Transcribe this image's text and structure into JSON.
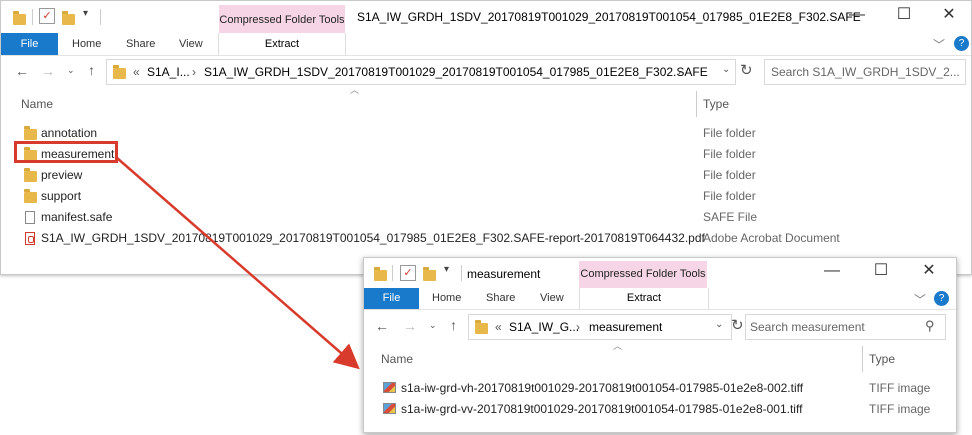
{
  "window_main": {
    "title": "S1A_IW_GRDH_1SDV_20170819T001029_20170819T001054_017985_01E2E8_F302.SAFE",
    "context_tab": "Compressed Folder Tools",
    "ribbon_tabs": [
      "File",
      "Home",
      "Share",
      "View"
    ],
    "extract_label": "Extract",
    "address": {
      "prefix": "«",
      "crumbs": [
        "S1A_I...",
        "S1A_IW_GRDH_1SDV_20170819T001029_20170819T001054_017985_01E2E8_F302.SAFE"
      ]
    },
    "search_placeholder": "Search S1A_IW_GRDH_1SDV_2...",
    "columns": {
      "name": "Name",
      "type": "Type"
    },
    "items": [
      {
        "name": "annotation",
        "type": "File folder",
        "icon": "folder-icon"
      },
      {
        "name": "measurement",
        "type": "File folder",
        "icon": "folder-icon"
      },
      {
        "name": "preview",
        "type": "File folder",
        "icon": "folder-icon"
      },
      {
        "name": "support",
        "type": "File folder",
        "icon": "folder-icon"
      },
      {
        "name": "manifest.safe",
        "type": "SAFE File",
        "icon": "file-icon"
      },
      {
        "name": "S1A_IW_GRDH_1SDV_20170819T001029_20170819T001054_017985_01E2E8_F302.SAFE-report-20170819T064432.pdf",
        "type": "Adobe Acrobat Document",
        "icon": "pdf-icon"
      }
    ]
  },
  "window_measurement": {
    "title": "measurement",
    "context_tab": "Compressed Folder Tools",
    "ribbon_tabs": [
      "File",
      "Home",
      "Share",
      "View"
    ],
    "extract_label": "Extract",
    "address": {
      "prefix": "«",
      "crumbs": [
        "S1A_IW_G...",
        "measurement"
      ]
    },
    "search_placeholder": "Search measurement",
    "columns": {
      "name": "Name",
      "type": "Type"
    },
    "items": [
      {
        "name": "s1a-iw-grd-vh-20170819t001029-20170819t001054-017985-01e2e8-002.tiff",
        "type": "TIFF image",
        "icon": "tiff-icon"
      },
      {
        "name": "s1a-iw-grd-vv-20170819t001029-20170819t001054-017985-01e2e8-001.tiff",
        "type": "TIFF image",
        "icon": "tiff-icon"
      }
    ]
  },
  "colors": {
    "file_tab": "#1979ca",
    "context_tab": "#f6d6e6",
    "highlight": "#d83a2b",
    "folder": "#e8b94a"
  }
}
